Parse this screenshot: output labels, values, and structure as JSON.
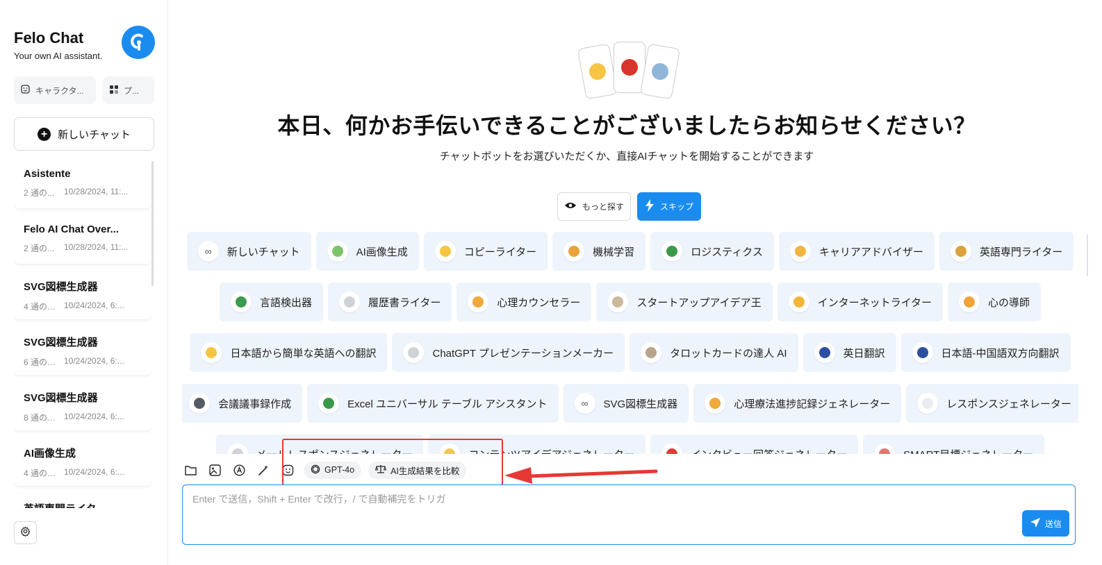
{
  "sidebar": {
    "title": "Felo Chat",
    "subtitle": "Your own AI assistant.",
    "character_btn": "キャラクタ...",
    "plugin_btn": "プ...",
    "new_chat": "新しいチャット",
    "history": [
      {
        "title": "Asistente",
        "count": "2 通の...",
        "time": "10/28/2024, 11:..."
      },
      {
        "title": "Felo AI Chat Over...",
        "count": "2 通の...",
        "time": "10/28/2024, 11:..."
      },
      {
        "title": "SVG図標生成器",
        "count": "4 通のチ...",
        "time": "10/24/2024, 6:..."
      },
      {
        "title": "SVG図標生成器",
        "count": "6 通のチ...",
        "time": "10/24/2024, 6:..."
      },
      {
        "title": "SVG図標生成器",
        "count": "8 通のチ...",
        "time": "10/24/2024, 6:..."
      },
      {
        "title": "AI画像生成",
        "count": "4 通のチ...",
        "time": "10/24/2024, 6:..."
      },
      {
        "title": "英語専門ライタ",
        "count": "",
        "time": ""
      }
    ]
  },
  "main": {
    "headline": "本日、何かお手伝いできることがございましたらお知らせください？",
    "subline": "チャットボットをお選びいただくか、直接AIチャットを開始することができます",
    "explore_btn": "もっと探す",
    "skip_btn": "スキップ",
    "bot_rows": [
      [
        {
          "label": "新しいチャット",
          "icon": "∞",
          "color": "#ffffff"
        },
        {
          "label": "AI画像生成",
          "icon": "",
          "color": "#7cc36b"
        },
        {
          "label": "コピーライター",
          "icon": "",
          "color": "#f5c542"
        },
        {
          "label": "機械学習",
          "icon": "",
          "color": "#e8a33a"
        },
        {
          "label": "ロジスティクス",
          "icon": "",
          "color": "#3a9a4a"
        },
        {
          "label": "キャリアアドバイザー",
          "icon": "",
          "color": "#f0b640"
        },
        {
          "label": "英語専門ライター",
          "icon": "",
          "color": "#d9a23a"
        }
      ],
      [
        {
          "label": "言語検出器",
          "icon": "",
          "color": "#3c9a4f"
        },
        {
          "label": "履歴書ライター",
          "icon": "",
          "color": "#cfd3d8"
        },
        {
          "label": "心理カウンセラー",
          "icon": "",
          "color": "#f0a93a"
        },
        {
          "label": "スタートアップアイデア王",
          "icon": "",
          "color": "#c9b89a"
        },
        {
          "label": "インターネットライター",
          "icon": "",
          "color": "#f2b53a"
        },
        {
          "label": "心の導師",
          "icon": "",
          "color": "#f0a33a"
        }
      ],
      [
        {
          "label": "日本語から簡単な英語への翻訳",
          "icon": "",
          "color": "#f5c542"
        },
        {
          "label": "ChatGPT プレゼンテーションメーカー",
          "icon": "",
          "color": "#cfd3d8"
        },
        {
          "label": "タロットカードの達人 AI",
          "icon": "",
          "color": "#b8a48a"
        },
        {
          "label": "英日翻訳",
          "icon": "",
          "color": "#2b4fa0"
        },
        {
          "label": "日本語-中国語双方向翻訳",
          "icon": "",
          "color": "#2b4fa0"
        }
      ],
      [
        {
          "label": "会議議事録作成",
          "icon": "",
          "color": "#555b66"
        },
        {
          "label": "Excel ユニバーサル テーブル アシスタント",
          "icon": "",
          "color": "#3a9a4a"
        },
        {
          "label": "SVG図標生成器",
          "icon": "∞",
          "color": "#ffffff"
        },
        {
          "label": "心理療法進捗記録ジェネレーター",
          "icon": "",
          "color": "#f0a93a"
        },
        {
          "label": "レスポンスジェネレーター",
          "icon": "",
          "color": "#e9ecf0"
        }
      ],
      [
        {
          "label": "メールレスポンスジェネレーター",
          "icon": "",
          "color": "#cfd3d8"
        },
        {
          "label": "コンテンツアイデアジェネレーター",
          "icon": "",
          "color": "#f2c94c"
        },
        {
          "label": "インタビュー回答ジェネレーター",
          "icon": "",
          "color": "#e53935"
        },
        {
          "label": "SMART目標ジェネレーター",
          "icon": "",
          "color": "#e57373"
        }
      ]
    ],
    "model_pill": "GPT-4o",
    "compare_pill": "AI生成結果を比較",
    "input_placeholder": "Enter で送信，Shift + Enter で改行，/ で自動補完をトリガ",
    "send_btn": "送信"
  },
  "colors": {
    "accent": "#1a8cf0",
    "bot_bg": "#eef4fb",
    "annotation": "#e53935"
  }
}
